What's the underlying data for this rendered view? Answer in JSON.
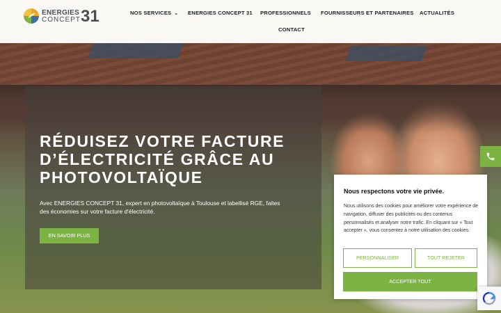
{
  "brand": {
    "line1": "ENERGIES",
    "line2": "CONCEPT",
    "number": "31",
    "accent_color": "#7cb342"
  },
  "nav": {
    "items": [
      {
        "label": "NOS SERVICES",
        "has_dropdown": true
      },
      {
        "label": "ENERGIES CONCEPT 31"
      },
      {
        "label": "PROFESSIONNELS"
      },
      {
        "label": "FOURNISSEURS ET PARTENAIRES"
      },
      {
        "label": "ACTUALITÉS"
      },
      {
        "label": "CONTACT"
      }
    ],
    "dropdown_icon": "chevron-down-icon"
  },
  "hero": {
    "title": "RÉDUISEZ VOTRE FACTURE D’ÉLECTRICITÉ GRÂCE AU PHOTOVOLTAÏQUE",
    "text": "Avec ENERGIES CONCEPT 31, expert en photovoltaïque à Toulouse et labellisé RGE, faites des économies sur votre facture d'électricité.",
    "cta_label": "EN SAVOIR PLUS"
  },
  "phone_button": {
    "icon": "phone-icon"
  },
  "cookie": {
    "title": "Nous respectons votre vie privée.",
    "text": "Nous utilisons des cookies pour améliorer votre expérience de navigation, diffuser des publicités ou des contenus personnalisés et analyser notre trafic. En cliquant sur « Tout accepter », vous consentez à notre utilisation des cookies.",
    "customize_label": "PERSONNALISER",
    "reject_label": "TOUT REJETER",
    "accept_label": "ACCEPTER TOUT"
  },
  "recaptcha": {
    "icon": "recaptcha-icon"
  }
}
